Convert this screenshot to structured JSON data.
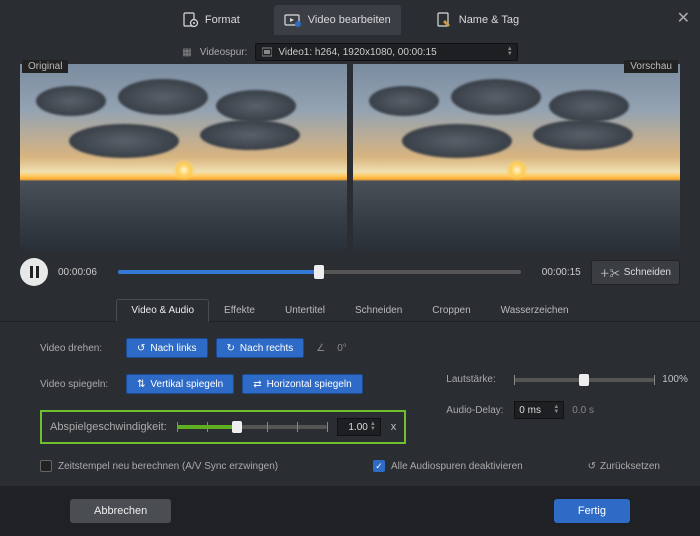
{
  "top_tabs": {
    "format": "Format",
    "edit": "Video bearbeiten",
    "name_tag": "Name & Tag"
  },
  "track": {
    "label": "Videospur:",
    "value": "Video1: h264, 1920x1080, 00:00:15"
  },
  "pane_labels": {
    "original": "Original",
    "preview": "Vorschau"
  },
  "timeline": {
    "current": "00:00:06",
    "total": "00:00:15",
    "cut": "Schneiden"
  },
  "sub_tabs": {
    "video_audio": "Video & Audio",
    "effects": "Effekte",
    "subtitles": "Untertitel",
    "cut": "Schneiden",
    "crop": "Croppen",
    "watermark": "Wasserzeichen"
  },
  "rotate": {
    "label": "Video drehen:",
    "left": "Nach links",
    "right": "Nach rechts",
    "angle_symbol": "∠",
    "angle": "0°"
  },
  "mirror": {
    "label": "Video spiegeln:",
    "vertical": "Vertikal spiegeln",
    "horizontal": "Horizontal spiegeln"
  },
  "speed": {
    "label": "Abspielgeschwindigkeit:",
    "value": "1.00",
    "suffix": "x"
  },
  "volume": {
    "label": "Lautstärke:",
    "value": "100%"
  },
  "audio_delay": {
    "label": "Audio-Delay:",
    "value": "0 ms",
    "actual": "0.0 s"
  },
  "timestamp_cb": "Zeitstempel neu berechnen (A/V Sync erzwingen)",
  "disable_audio_cb": "Alle Audiospuren deaktivieren",
  "reset": "Zurücksetzen",
  "footer": {
    "cancel": "Abbrechen",
    "done": "Fertig"
  }
}
